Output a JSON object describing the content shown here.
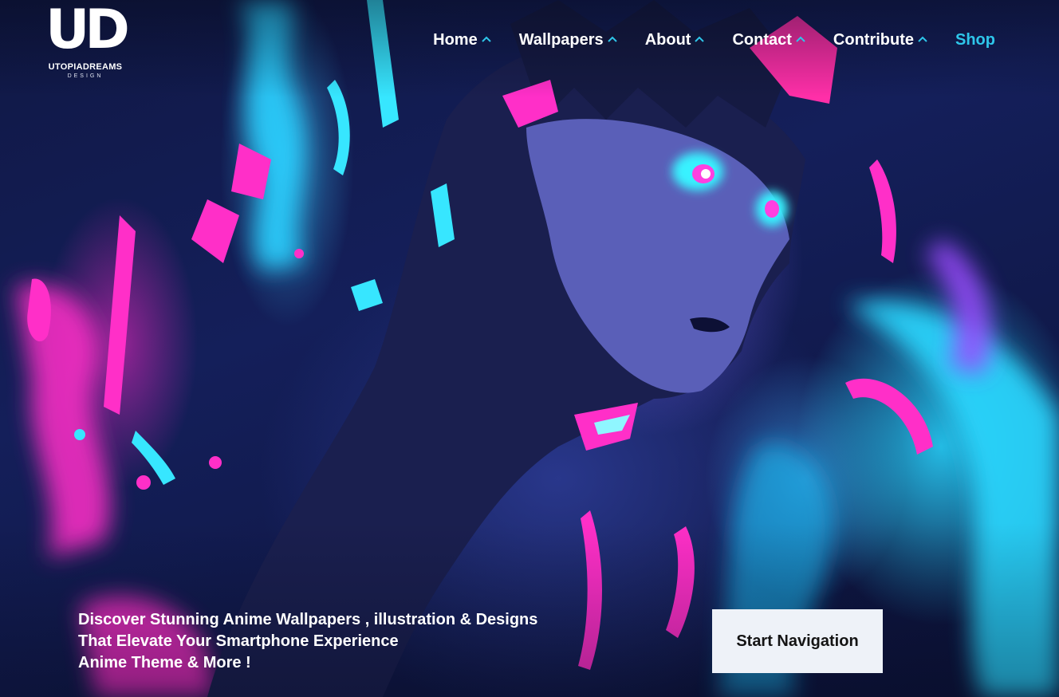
{
  "brand": {
    "mark": "UD",
    "name": "UTOPIADREAMS",
    "tagline": "DESIGN"
  },
  "nav": {
    "items": [
      {
        "label": "Home",
        "has_dropdown": true,
        "active": false
      },
      {
        "label": "Wallpapers",
        "has_dropdown": true,
        "active": false
      },
      {
        "label": "About",
        "has_dropdown": true,
        "active": false
      },
      {
        "label": "Contact",
        "has_dropdown": true,
        "active": false
      },
      {
        "label": "Contribute",
        "has_dropdown": true,
        "active": false
      },
      {
        "label": "Shop",
        "has_dropdown": false,
        "active": true
      }
    ]
  },
  "hero": {
    "lines": [
      "Discover Stunning Anime Wallpapers , illustration & Designs",
      "That Elevate Your Smartphone Experience",
      "Anime Theme & More !"
    ],
    "cta_label": "Start Navigation"
  },
  "colors": {
    "accent": "#2ec6ea",
    "neon_pink": "#ff2fc8",
    "neon_cyan": "#2ee0ff",
    "cta_bg": "#eef2f8",
    "nav_text": "#ffffff"
  },
  "icons": {
    "dropdown": "chevron-up-icon"
  }
}
